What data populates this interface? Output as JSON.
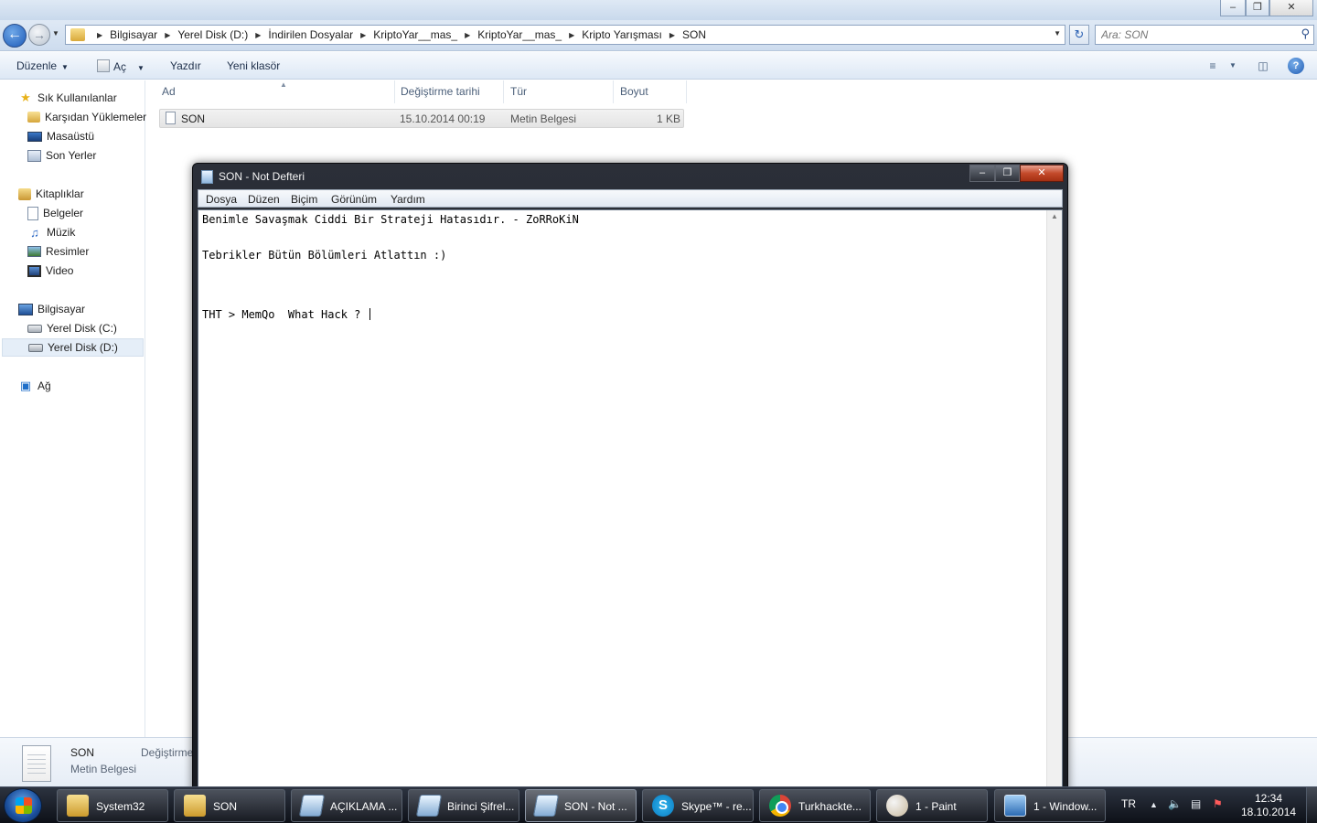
{
  "address": {
    "breadcrumbs": [
      "Bilgisayar",
      "Yerel Disk (D:)",
      "İndirilen Dosyalar",
      "KriptoYar__mas_",
      "KriptoYar__mas_",
      "Kripto Yarışması",
      "SON"
    ],
    "search_placeholder": "Ara: SON"
  },
  "commandbar": {
    "organize": "Düzenle",
    "open": "Aç",
    "print": "Yazdır",
    "new_folder": "Yeni klasör"
  },
  "navpane": {
    "favorites": {
      "label": "Sık Kullanılanlar",
      "items": [
        {
          "label": "Karşıdan Yüklemeler"
        },
        {
          "label": "Masaüstü"
        },
        {
          "label": "Son Yerler"
        }
      ]
    },
    "libraries": {
      "label": "Kitaplıklar",
      "items": [
        {
          "label": "Belgeler"
        },
        {
          "label": "Müzik"
        },
        {
          "label": "Resimler"
        },
        {
          "label": "Video"
        }
      ]
    },
    "computer": {
      "label": "Bilgisayar",
      "items": [
        {
          "label": "Yerel Disk (C:)"
        },
        {
          "label": "Yerel Disk (D:)"
        }
      ]
    },
    "network": {
      "label": "Ağ"
    }
  },
  "filelist": {
    "columns": [
      "Ad",
      "Değiştirme tarihi",
      "Tür",
      "Boyut"
    ],
    "rows": [
      {
        "name": "SON",
        "modified": "15.10.2014 00:19",
        "type": "Metin Belgesi",
        "size": "1 KB"
      }
    ]
  },
  "details": {
    "name": "SON",
    "type": "Metin Belgesi",
    "modified_label": "Değiştirme"
  },
  "notepad": {
    "title": "SON - Not Defteri",
    "menu": [
      "Dosya",
      "Düzen",
      "Biçim",
      "Görünüm",
      "Yardım"
    ],
    "lines": [
      "Benimle Savaşmak Ciddi Bir Strateji Hatasıdır. - ZoRRoKiN",
      "Tebrikler Bütün Bölümleri Atlattın :)",
      "THT > MemQo  What Hack ? "
    ]
  },
  "taskbar": {
    "tasks": [
      {
        "label": "System32",
        "icon": "folder-icon"
      },
      {
        "label": "SON",
        "icon": "folder-icon"
      },
      {
        "label": "AÇIKLAMA ...",
        "icon": "notepad-icon"
      },
      {
        "label": "Birinci Şifrel...",
        "icon": "notepad-icon"
      },
      {
        "label": "SON - Not ...",
        "icon": "notepad-icon"
      },
      {
        "label": "Skype™ - re...",
        "icon": "skype-icon"
      },
      {
        "label": "Turkhackte...",
        "icon": "chrome-icon"
      },
      {
        "label": "1 - Paint",
        "icon": "paint-icon"
      },
      {
        "label": "1 - Window...",
        "icon": "remote-desktop-icon"
      }
    ],
    "language": "TR",
    "time": "12:34",
    "date": "18.10.2014"
  }
}
